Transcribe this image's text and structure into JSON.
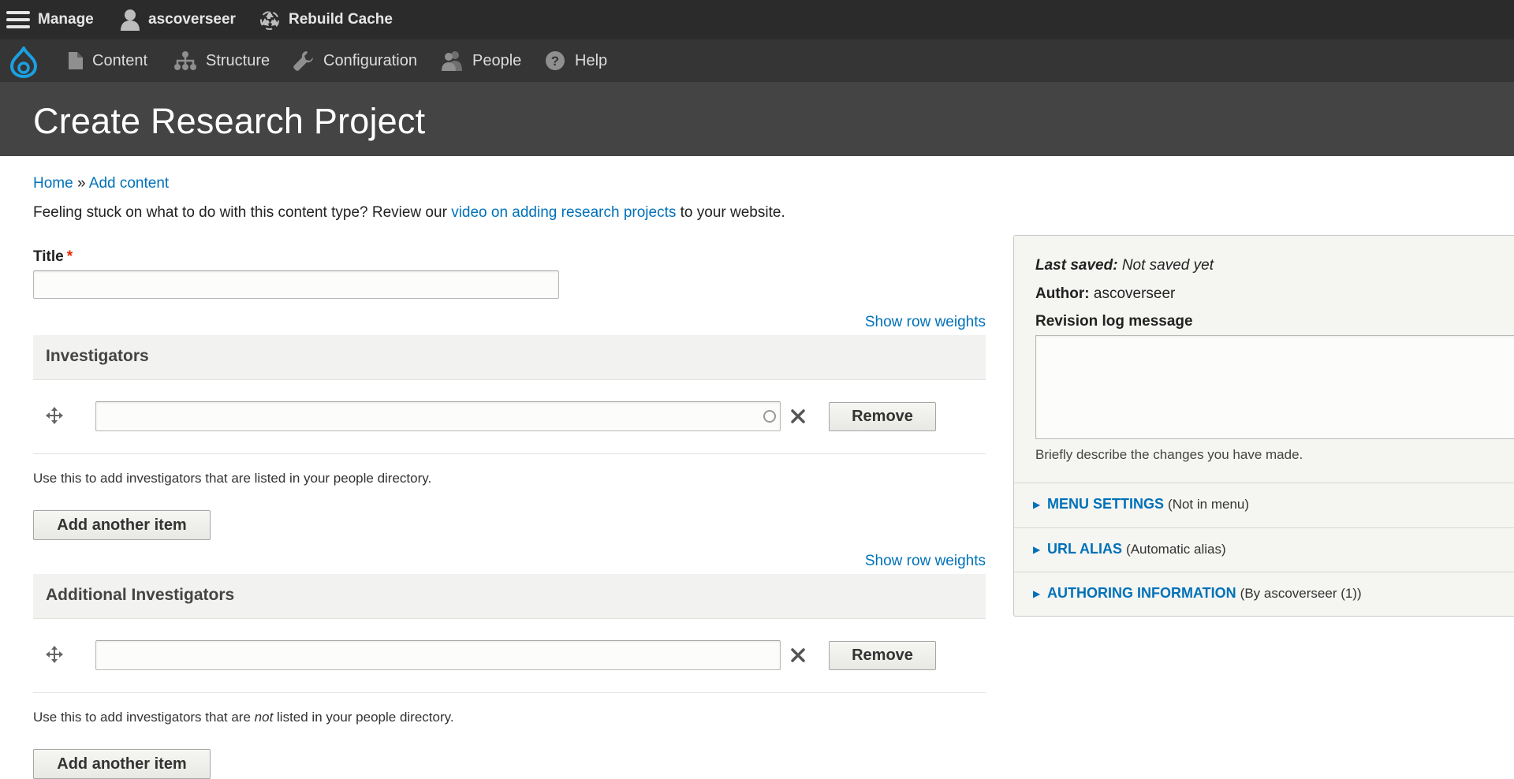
{
  "toolbar": {
    "manage_label": "Manage",
    "user_label": "ascoverseer",
    "rebuild_label": "Rebuild Cache"
  },
  "tray": {
    "items": [
      {
        "label": "Content",
        "icon": "file-icon"
      },
      {
        "label": "Structure",
        "icon": "structure-icon"
      },
      {
        "label": "Configuration",
        "icon": "wrench-icon"
      },
      {
        "label": "People",
        "icon": "people-icon"
      },
      {
        "label": "Help",
        "icon": "help-icon"
      }
    ]
  },
  "page": {
    "title": "Create Research Project"
  },
  "breadcrumb": {
    "home": "Home",
    "separator": "»",
    "add_content": "Add content"
  },
  "intro": {
    "before": "Feeling stuck on what to do with this content type? Review our ",
    "link": "video on adding research projects",
    "after": " to your website."
  },
  "form": {
    "title_label": "Title",
    "required_mark": "*",
    "title_value": "",
    "show_row_weights": "Show row weights",
    "investigators": {
      "header": "Investigators",
      "value": "",
      "remove_label": "Remove",
      "description": "Use this to add investigators that are listed in your people directory.",
      "add_label": "Add another item"
    },
    "additional_investigators": {
      "header": "Additional Investigators",
      "value": "",
      "remove_label": "Remove",
      "desc_before": "Use this to add investigators that are ",
      "desc_em": "not",
      "desc_after": " listed in your people directory.",
      "add_label": "Add another item"
    }
  },
  "sidebar": {
    "last_saved_label": "Last saved:",
    "last_saved_value": " Not saved yet",
    "author_label": "Author:",
    "author_value": " ascoverseer",
    "revision_label": "Revision log message",
    "revision_value": "",
    "revision_help": "Briefly describe the changes you have made.",
    "sections": [
      {
        "title": "MENU SETTINGS",
        "summary": "(Not in menu)"
      },
      {
        "title": "URL ALIAS",
        "summary": "(Automatic alias)"
      },
      {
        "title": "AUTHORING INFORMATION",
        "summary": "(By ascoverseer (1))"
      }
    ]
  },
  "colors": {
    "link": "#0071b8",
    "required": "#e62600",
    "toolbar": "#2b2b2b",
    "header": "#444444"
  }
}
